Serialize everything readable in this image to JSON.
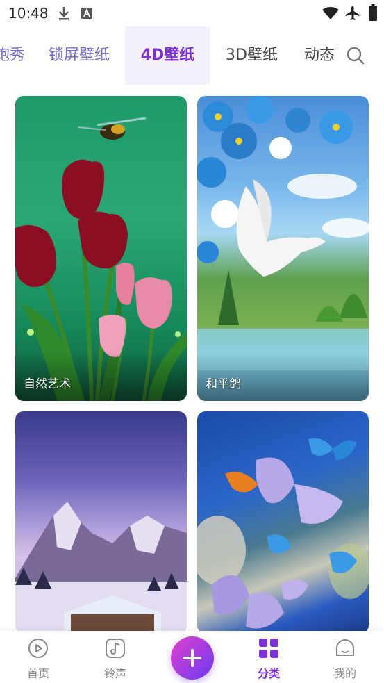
{
  "status_bar": {
    "time": "10:48",
    "icons": [
      "download-icon",
      "a-badge-icon",
      "wifi-icon",
      "airplane-icon",
      "battery-icon"
    ]
  },
  "tabs": {
    "items": [
      {
        "label": "炮秀"
      },
      {
        "label": "锁屏壁纸"
      },
      {
        "label": "4D壁纸",
        "active": true
      },
      {
        "label": "3D壁纸"
      },
      {
        "label": "动态"
      }
    ]
  },
  "grid": {
    "cards": [
      {
        "caption": "自然艺术",
        "art": "tulips-and-bee"
      },
      {
        "caption": "和平鸽",
        "art": "dove-and-flowers"
      },
      {
        "caption": "",
        "art": "snowy-mountain-cabin"
      },
      {
        "caption": "",
        "art": "blue-butterflies"
      }
    ]
  },
  "bottom_nav": {
    "items": [
      {
        "label": "首页",
        "icon": "play-circle-icon"
      },
      {
        "label": "铃声",
        "icon": "music-note-icon"
      },
      {
        "label": "分类",
        "icon": "grid-icon",
        "active": true
      },
      {
        "label": "我的",
        "icon": "smiley-icon"
      }
    ],
    "fab_icon": "plus-icon"
  },
  "colors": {
    "accent": "#7c2fd8",
    "tab_inactive": "#7c6ad0",
    "tab_active_bg": "#f4f0fc"
  }
}
